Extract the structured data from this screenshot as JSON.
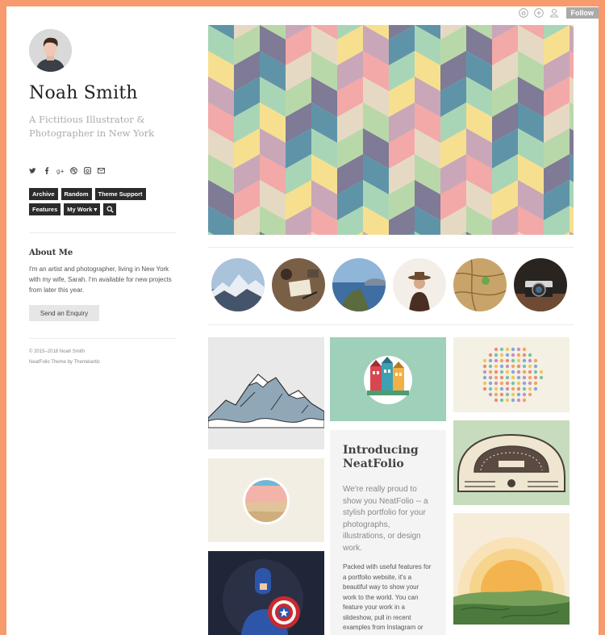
{
  "topbar": {
    "icons": [
      "home-icon",
      "plus-circle-icon",
      "user-icon"
    ],
    "follow_label": "Follow"
  },
  "profile": {
    "name": "Noah Smith",
    "tagline": "A Fictitious Illustrator & Photographer in New York"
  },
  "social_icons": [
    "twitter-icon",
    "facebook-icon",
    "google-plus-icon",
    "dribbble-icon",
    "instagram-icon",
    "email-icon"
  ],
  "nav": {
    "items": [
      "Archive",
      "Random",
      "Theme Support",
      "Features"
    ],
    "dropdown_label": "My Work ▾",
    "search_icon": "search-icon"
  },
  "about": {
    "title": "About Me",
    "text": "I'm an artist and photographer, living in New York with my wife, Sarah. I'm available for new projects from later this year.",
    "button_label": "Send an Enquiry"
  },
  "footer": {
    "copyright": "© 2015–2018 Noah Smith",
    "credit": "NeatFolio Theme by Themelantic"
  },
  "post": {
    "title": "Introducing NeatFolio",
    "lead": "We're really proud to show you NeatFolio -- a stylish portfolio for your photographs, illustrations, or design work.",
    "body": "Packed with useful features for a portfolio website, it's a beautiful way to show your work to the world. You can feature your work in a slideshow, pull in recent examples from Instagram or Dribbble, and feature a short"
  },
  "colors": {
    "border": "#f79a6e",
    "nav_button": "#2b2b2b",
    "follow": "#aaaaaa"
  }
}
